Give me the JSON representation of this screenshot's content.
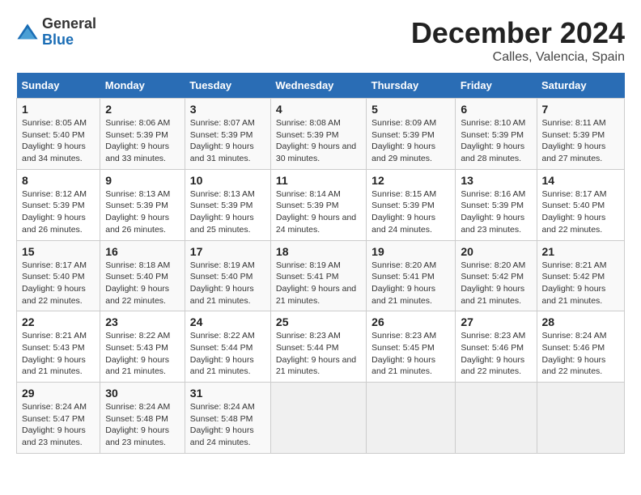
{
  "header": {
    "logo_general": "General",
    "logo_blue": "Blue",
    "title": "December 2024",
    "subtitle": "Calles, Valencia, Spain"
  },
  "calendar": {
    "columns": [
      "Sunday",
      "Monday",
      "Tuesday",
      "Wednesday",
      "Thursday",
      "Friday",
      "Saturday"
    ],
    "weeks": [
      [
        null,
        {
          "day": "2",
          "sunrise": "8:06 AM",
          "sunset": "5:39 PM",
          "daylight": "9 hours and 33 minutes."
        },
        {
          "day": "3",
          "sunrise": "8:07 AM",
          "sunset": "5:39 PM",
          "daylight": "9 hours and 31 minutes."
        },
        {
          "day": "4",
          "sunrise": "8:08 AM",
          "sunset": "5:39 PM",
          "daylight": "9 hours and 30 minutes."
        },
        {
          "day": "5",
          "sunrise": "8:09 AM",
          "sunset": "5:39 PM",
          "daylight": "9 hours and 29 minutes."
        },
        {
          "day": "6",
          "sunrise": "8:10 AM",
          "sunset": "5:39 PM",
          "daylight": "9 hours and 28 minutes."
        },
        {
          "day": "7",
          "sunrise": "8:11 AM",
          "sunset": "5:39 PM",
          "daylight": "9 hours and 27 minutes."
        }
      ],
      [
        {
          "day": "1",
          "sunrise": "8:05 AM",
          "sunset": "5:40 PM",
          "daylight": "9 hours and 34 minutes."
        },
        {
          "day": "9",
          "sunrise": "8:13 AM",
          "sunset": "5:39 PM",
          "daylight": "9 hours and 26 minutes."
        },
        {
          "day": "10",
          "sunrise": "8:13 AM",
          "sunset": "5:39 PM",
          "daylight": "9 hours and 25 minutes."
        },
        {
          "day": "11",
          "sunrise": "8:14 AM",
          "sunset": "5:39 PM",
          "daylight": "9 hours and 24 minutes."
        },
        {
          "day": "12",
          "sunrise": "8:15 AM",
          "sunset": "5:39 PM",
          "daylight": "9 hours and 24 minutes."
        },
        {
          "day": "13",
          "sunrise": "8:16 AM",
          "sunset": "5:39 PM",
          "daylight": "9 hours and 23 minutes."
        },
        {
          "day": "14",
          "sunrise": "8:17 AM",
          "sunset": "5:40 PM",
          "daylight": "9 hours and 22 minutes."
        }
      ],
      [
        {
          "day": "8",
          "sunrise": "8:12 AM",
          "sunset": "5:39 PM",
          "daylight": "9 hours and 26 minutes."
        },
        {
          "day": "16",
          "sunrise": "8:18 AM",
          "sunset": "5:40 PM",
          "daylight": "9 hours and 22 minutes."
        },
        {
          "day": "17",
          "sunrise": "8:19 AM",
          "sunset": "5:40 PM",
          "daylight": "9 hours and 21 minutes."
        },
        {
          "day": "18",
          "sunrise": "8:19 AM",
          "sunset": "5:41 PM",
          "daylight": "9 hours and 21 minutes."
        },
        {
          "day": "19",
          "sunrise": "8:20 AM",
          "sunset": "5:41 PM",
          "daylight": "9 hours and 21 minutes."
        },
        {
          "day": "20",
          "sunrise": "8:20 AM",
          "sunset": "5:42 PM",
          "daylight": "9 hours and 21 minutes."
        },
        {
          "day": "21",
          "sunrise": "8:21 AM",
          "sunset": "5:42 PM",
          "daylight": "9 hours and 21 minutes."
        }
      ],
      [
        {
          "day": "15",
          "sunrise": "8:17 AM",
          "sunset": "5:40 PM",
          "daylight": "9 hours and 22 minutes."
        },
        {
          "day": "23",
          "sunrise": "8:22 AM",
          "sunset": "5:43 PM",
          "daylight": "9 hours and 21 minutes."
        },
        {
          "day": "24",
          "sunrise": "8:22 AM",
          "sunset": "5:44 PM",
          "daylight": "9 hours and 21 minutes."
        },
        {
          "day": "25",
          "sunrise": "8:23 AM",
          "sunset": "5:44 PM",
          "daylight": "9 hours and 21 minutes."
        },
        {
          "day": "26",
          "sunrise": "8:23 AM",
          "sunset": "5:45 PM",
          "daylight": "9 hours and 21 minutes."
        },
        {
          "day": "27",
          "sunrise": "8:23 AM",
          "sunset": "5:46 PM",
          "daylight": "9 hours and 22 minutes."
        },
        {
          "day": "28",
          "sunrise": "8:24 AM",
          "sunset": "5:46 PM",
          "daylight": "9 hours and 22 minutes."
        }
      ],
      [
        {
          "day": "22",
          "sunrise": "8:21 AM",
          "sunset": "5:43 PM",
          "daylight": "9 hours and 21 minutes."
        },
        {
          "day": "30",
          "sunrise": "8:24 AM",
          "sunset": "5:48 PM",
          "daylight": "9 hours and 23 minutes."
        },
        {
          "day": "31",
          "sunrise": "8:24 AM",
          "sunset": "5:48 PM",
          "daylight": "9 hours and 24 minutes."
        },
        null,
        null,
        null,
        null
      ],
      [
        {
          "day": "29",
          "sunrise": "8:24 AM",
          "sunset": "5:47 PM",
          "daylight": "9 hours and 23 minutes."
        },
        null,
        null,
        null,
        null,
        null,
        null
      ]
    ]
  },
  "labels": {
    "sunrise_label": "Sunrise:",
    "sunset_label": "Sunset:",
    "daylight_label": "Daylight:"
  }
}
